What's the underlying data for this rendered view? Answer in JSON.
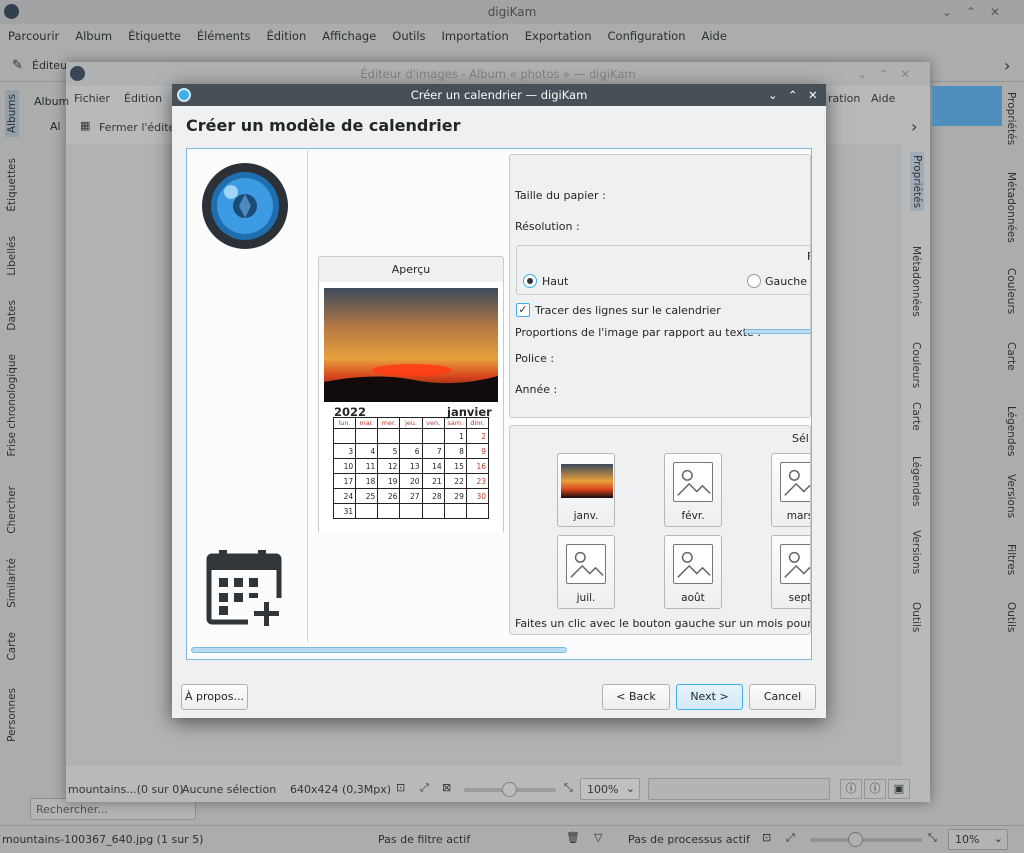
{
  "main": {
    "title": "digiKam",
    "menu": [
      "Parcourir",
      "Album",
      "Étiquette",
      "Éléments",
      "Édition",
      "Affichage",
      "Outils",
      "Importation",
      "Exportation",
      "Configuration",
      "Aide"
    ],
    "toolbar_label": "Éditeu",
    "left_tabs": [
      "Albums",
      "Étiquettes",
      "Libellés",
      "Dates",
      "Frise chronologique",
      "Chercher",
      "Similarité",
      "Carte",
      "Personnes"
    ],
    "right_tabs": [
      "Propriétés",
      "Métadonnées",
      "Couleurs",
      "Carte",
      "Légendes",
      "Versions",
      "Filtres",
      "Outils"
    ],
    "search_placeholder": "Rechercher...",
    "status_file": "mountains-100367_640.jpg (1 sur 5)",
    "status_filter": "Pas de filtre actif",
    "status_process": "Pas de processus actif",
    "status_zoom": "10%"
  },
  "editor": {
    "title": "Éditeur d'images - Album « photos » — digiKam",
    "menu": [
      "Fichier",
      "Édition"
    ],
    "menu_right": [
      "ration",
      "Aide"
    ],
    "album_label": "Album",
    "album_item": "Al",
    "close_label": "Fermer l'édite",
    "right_tabs": [
      "Propriétés",
      "Métadonnées",
      "Couleurs",
      "Carte",
      "Légendes",
      "Versions",
      "Outils"
    ],
    "status_file": "mountains...(0 sur 0)",
    "status_selection": "Aucune sélection",
    "status_size": "640x424 (0,3Mpx)",
    "zoom": "100%"
  },
  "dialog": {
    "title": "Créer un calendrier — digiKam",
    "heading": "Créer un modèle de calendrier",
    "preview_title": "Aperçu",
    "cal_year": "2022",
    "cal_month": "janvier",
    "weekdays": [
      "lun.",
      "mar.",
      "mer.",
      "jeu.",
      "ven.",
      "sam.",
      "dim."
    ],
    "weeks": [
      [
        "",
        "",
        "",
        "",
        "",
        "1",
        "2"
      ],
      [
        "3",
        "4",
        "5",
        "6",
        "7",
        "8",
        "9"
      ],
      [
        "10",
        "11",
        "12",
        "13",
        "14",
        "15",
        "16"
      ],
      [
        "17",
        "18",
        "19",
        "20",
        "21",
        "22",
        "23"
      ],
      [
        "24",
        "25",
        "26",
        "27",
        "28",
        "29",
        "30"
      ],
      [
        "31",
        "",
        "",
        "",
        "",
        "",
        ""
      ]
    ],
    "paper_size_label": "Taille du papier :",
    "resolution_label": "Résolution :",
    "group_title_partial": "F",
    "radio_top": "Haut",
    "radio_left": "Gauche",
    "draw_lines_label": "Tracer des lignes sur le calendrier",
    "ratio_label": "Proportions de l'image par rapport au texte :",
    "font_label": "Police :",
    "year_label": "Année :",
    "select_title_partial": "Sél",
    "months": [
      "janv.",
      "févr.",
      "mars",
      "juil.",
      "août",
      "sept"
    ],
    "hint": "Faites un clic avec le bouton gauche sur un mois pour sélect",
    "about_button": "À propos...",
    "back_button": "< Back",
    "next_button": "Next >",
    "cancel_button": "Cancel"
  }
}
